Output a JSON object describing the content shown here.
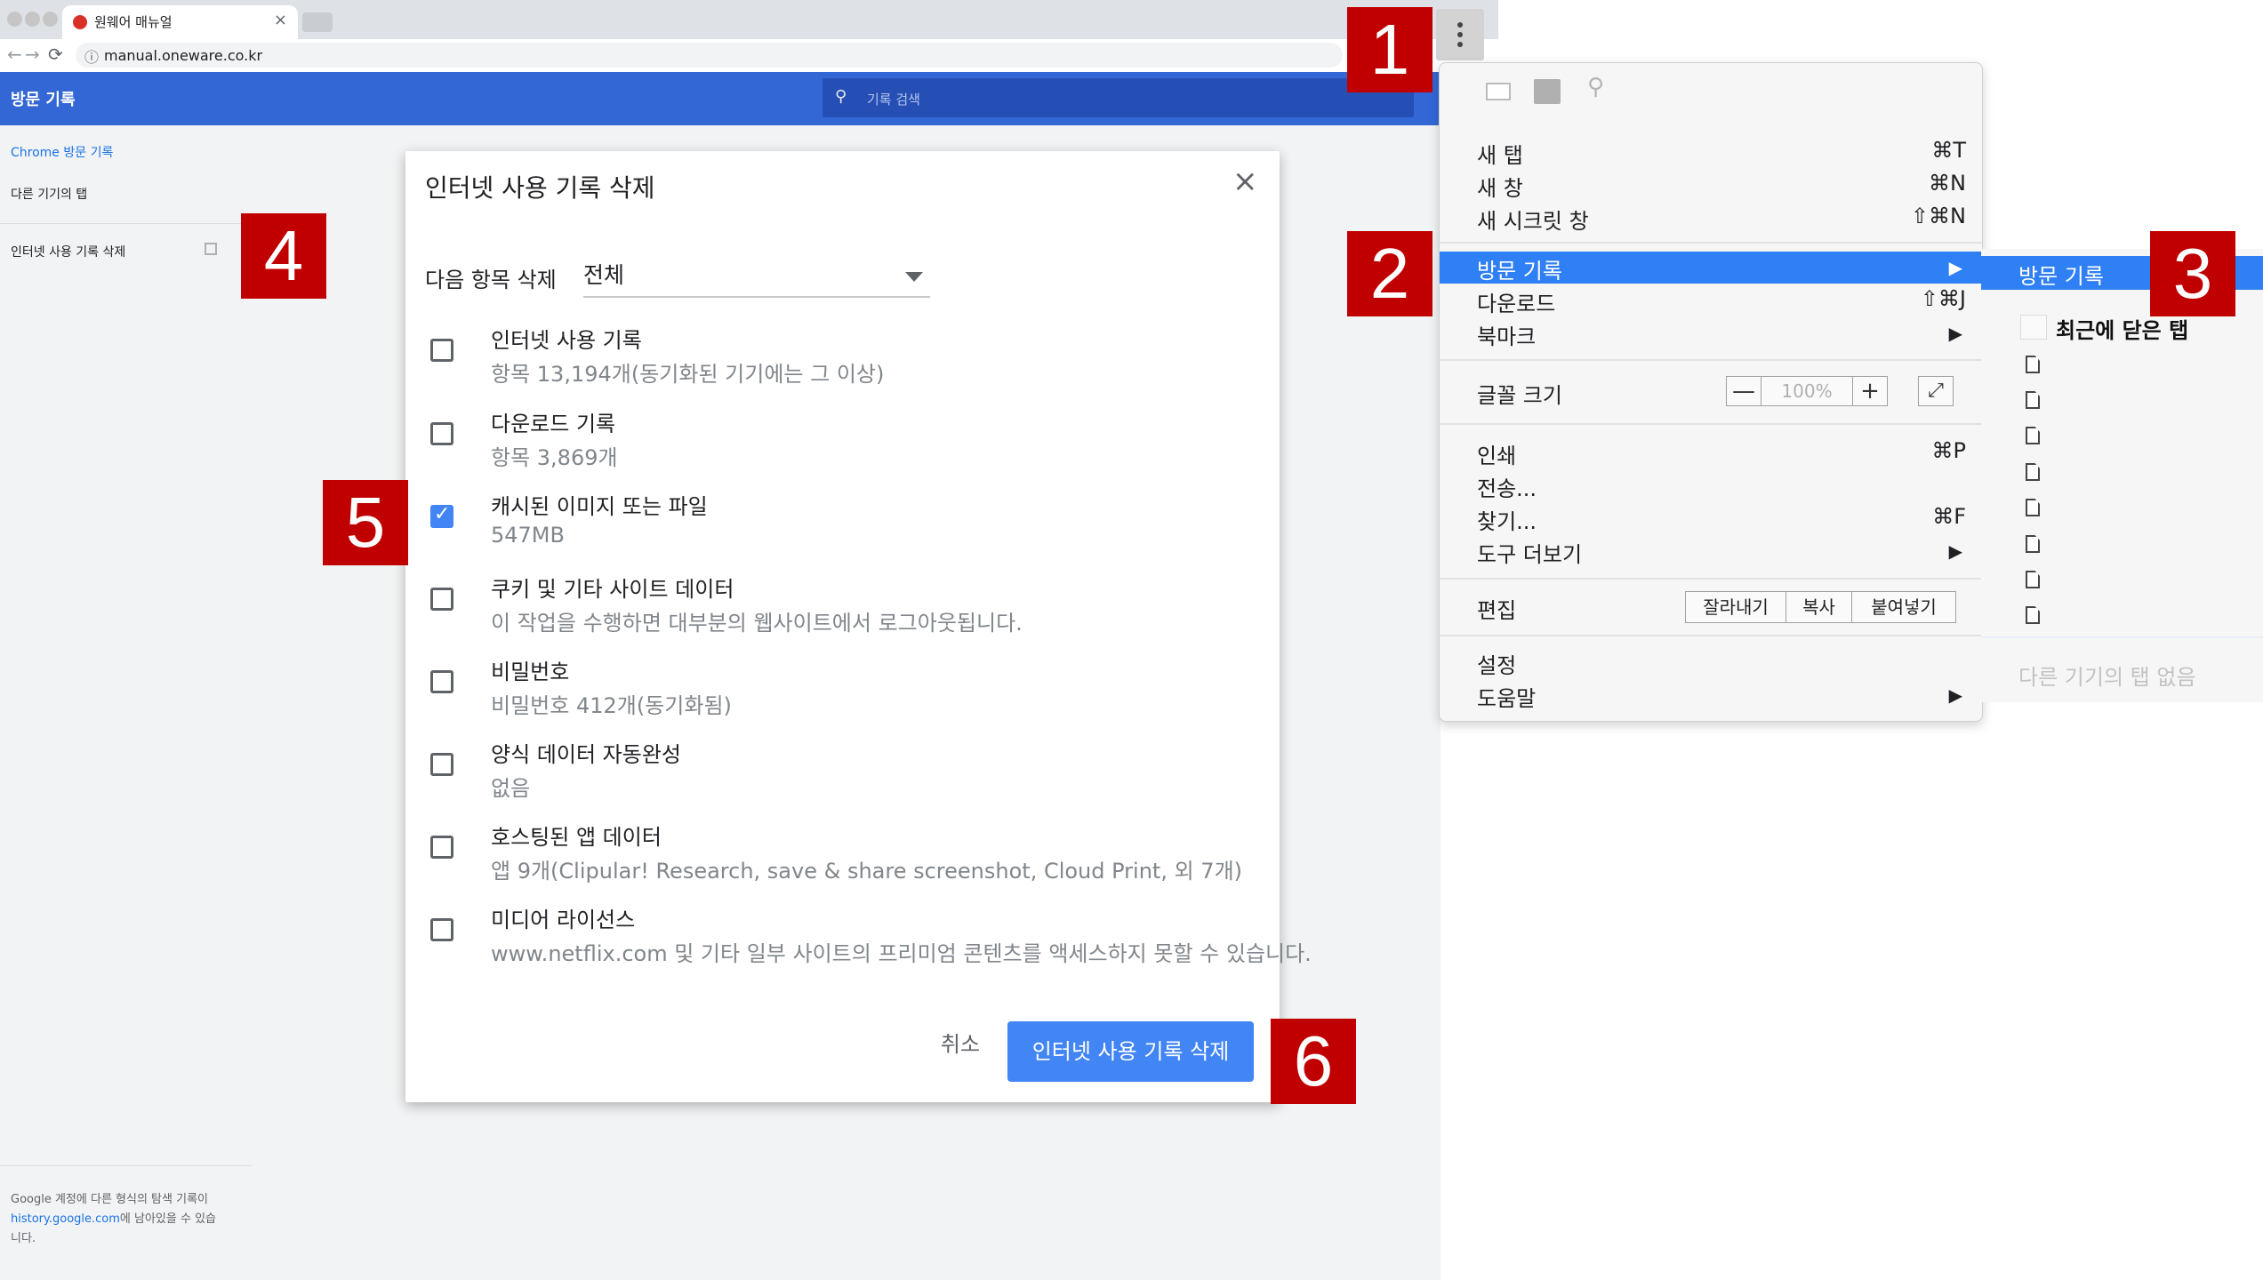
{
  "browser": {
    "tab_title": "원웨어 매뉴얼",
    "tab_close": "×",
    "url": "manual.oneware.co.kr",
    "nav_icons": {
      "back": "←",
      "forward": "→",
      "reload": "⟳",
      "info": "ⓘ"
    }
  },
  "history_page": {
    "header_title": "방문 기록",
    "search_placeholder": "기록 검색",
    "sidebar": {
      "items": [
        {
          "label": "Chrome 방문 기록",
          "active": true
        },
        {
          "label": "다른 기기의 탭",
          "active": false
        },
        {
          "label": "인터넷 사용 기록 삭제",
          "active": false
        }
      ],
      "footer_text_1": "Google 계정에 다른 형식의 탐색 기록이",
      "footer_link": "history.google.com",
      "footer_text_2": "에 남아있을 수 있습",
      "footer_text_3": "니다."
    }
  },
  "dialog": {
    "title": "인터넷 사용 기록 삭제",
    "close": "×",
    "range_label": "다음 항목 삭제",
    "range_value": "전체",
    "options": [
      {
        "title": "인터넷 사용 기록",
        "desc": "항목 13,194개(동기화된 기기에는 그 이상)",
        "checked": false
      },
      {
        "title": "다운로드 기록",
        "desc": "항목 3,869개",
        "checked": false
      },
      {
        "title": "캐시된 이미지 또는 파일",
        "desc": "547MB",
        "checked": true
      },
      {
        "title": "쿠키 및 기타 사이트 데이터",
        "desc": "이 작업을 수행하면 대부분의 웹사이트에서 로그아웃됩니다.",
        "checked": false
      },
      {
        "title": "비밀번호",
        "desc": "비밀번호 412개(동기화됨)",
        "checked": false
      },
      {
        "title": "양식 데이터 자동완성",
        "desc": "없음",
        "checked": false
      },
      {
        "title": "호스팅된 앱 데이터",
        "desc": "앱 9개(Clipular! Research, save & share screenshot, Cloud Print, 외 7개)",
        "checked": false
      },
      {
        "title": "미디어 라이선스",
        "desc": "www.netflix.com 및 기타 일부 사이트의 프리미엄 콘텐츠를 액세스하지 못할 수 있습니다.",
        "checked": false
      }
    ],
    "check_glyph": "✓",
    "cancel_label": "취소",
    "confirm_label": "인터넷 사용 기록 삭제"
  },
  "chrome_menu": {
    "new_tab": {
      "label": "새 탭",
      "shortcut": "⌘T"
    },
    "new_window": {
      "label": "새 창",
      "shortcut": "⌘N"
    },
    "incognito": {
      "label": "새 시크릿 창",
      "shortcut": "⇧⌘N"
    },
    "history": {
      "label": "방문 기록",
      "arrow": "▶"
    },
    "downloads": {
      "label": "다운로드",
      "shortcut": "⇧⌘J"
    },
    "bookmarks": {
      "label": "북마크",
      "arrow": "▶"
    },
    "zoom": {
      "label": "글꼴 크기",
      "minus": "—",
      "value": "100%",
      "plus": "+",
      "fullscreen": "⤢"
    },
    "print": {
      "label": "인쇄",
      "shortcut": "⌘P"
    },
    "cast": {
      "label": "전송..."
    },
    "find": {
      "label": "찾기...",
      "shortcut": "⌘F"
    },
    "more_tools": {
      "label": "도구 더보기",
      "arrow": "▶"
    },
    "edit": {
      "label": "편집",
      "cut": "잘라내기",
      "copy": "복사",
      "paste": "붙여넣기"
    },
    "settings": {
      "label": "설정"
    },
    "help": {
      "label": "도움말",
      "arrow": "▶"
    },
    "search_glyph": "⚲"
  },
  "history_submenu": {
    "history_label": "방문 기록",
    "recent_closed": "최근에 닫은 탭",
    "no_other_tabs": "다른 기기의 탭 없음"
  },
  "steps": [
    "1",
    "2",
    "3",
    "4",
    "5",
    "6"
  ],
  "colors": {
    "accent": "#3367d6",
    "button_blue": "#4285f4",
    "menu_highlight": "#2f7ff5",
    "step_badge": "#c00000",
    "page_background": "#f1f3f4"
  }
}
